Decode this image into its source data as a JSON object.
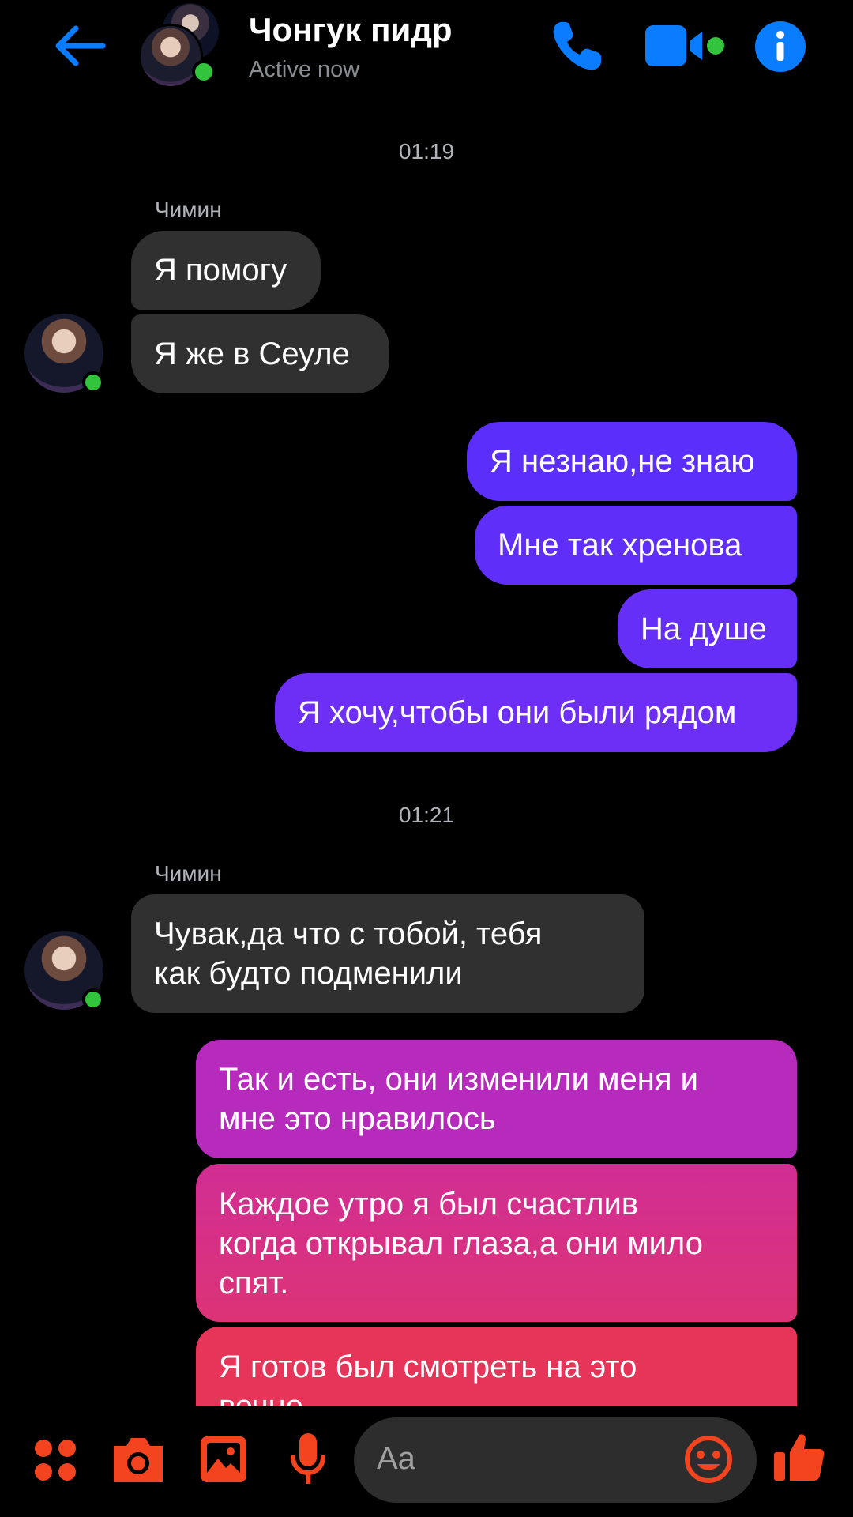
{
  "header": {
    "title": "Чонгук пидр",
    "status": "Active now"
  },
  "messages": {
    "time1": "01:19",
    "sender1": "Чимин",
    "in1": "Я помогу",
    "in2": "Я же в Сеуле",
    "out1": "Я незнаю,не знаю",
    "out2": "Мне так хренова",
    "out3": "На душе",
    "out4": "Я хочу,чтобы они были рядом",
    "time2": "01:21",
    "sender2": "Чимин",
    "in3_line1": "Чувак,да что с тобой, тебя",
    "in3_line2": "как будто подменили",
    "out5_line1": "Так и есть, они изменили меня и",
    "out5_line2": "мне это нравилось",
    "out6_line1": "Каждое утро я был счастлив",
    "out6_line2": "когда открывал глаза,а они мило",
    "out6_line3": "спят.",
    "out7_line1": "Я готов был смотреть на это",
    "out7_line2": "вечно"
  },
  "composer": {
    "placeholder": "Aa"
  },
  "colors": {
    "accent_blue": "#0a7cff",
    "composer_accent": "#f3431f",
    "online": "#31c43c",
    "incoming_bubble": "#303030"
  },
  "icons": [
    "back-arrow-icon",
    "phone-icon",
    "video-camera-icon",
    "info-icon",
    "apps-icon",
    "camera-icon",
    "gallery-icon",
    "microphone-icon",
    "emoji-icon",
    "thumbs-up-icon"
  ]
}
